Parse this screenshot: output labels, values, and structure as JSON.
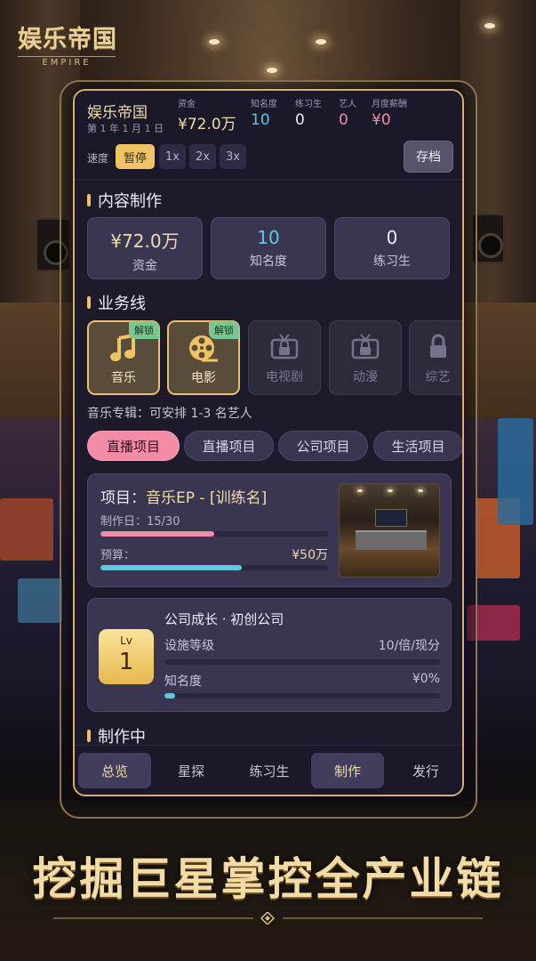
{
  "logo": {
    "title": "娱乐帝国",
    "subtitle": "EMPIRE"
  },
  "header": {
    "game_title": "娱乐帝国",
    "date": "第 1 年 1 月 1 日",
    "stats": [
      {
        "label": "资金",
        "value": "¥72.0万",
        "color": "#f1dca8"
      },
      {
        "label": "知名度",
        "value": "10",
        "color": "#5ec8e0"
      },
      {
        "label": "练习生",
        "value": "0",
        "color": "#ecebf5"
      },
      {
        "label": "艺人",
        "value": "0",
        "color": "#f28ca7"
      },
      {
        "label": "月度薪酬",
        "value": "¥0",
        "color": "#f28ca7"
      }
    ],
    "speed_label": "速度",
    "speed_options": [
      "暂停",
      "1x",
      "2x",
      "3x"
    ],
    "speed_selected": "暂停",
    "save_label": "存档"
  },
  "content_section": {
    "title": "内容制作",
    "cards": [
      {
        "value": "¥72.0万",
        "label": "资金",
        "color": "#f1dca8"
      },
      {
        "value": "10",
        "label": "知名度",
        "color": "#5ec8e0"
      },
      {
        "value": "0",
        "label": "练习生",
        "color": "#ecebf5"
      }
    ]
  },
  "business_section": {
    "title": "业务线",
    "items": [
      {
        "name": "音乐",
        "icon": "music-note-icon",
        "unlocked": true,
        "tag": "解锁"
      },
      {
        "name": "电影",
        "icon": "film-reel-icon",
        "unlocked": true,
        "tag": "解锁"
      },
      {
        "name": "电视剧",
        "icon": "lock-tv-icon",
        "unlocked": false
      },
      {
        "name": "动漫",
        "icon": "lock-tv-icon",
        "unlocked": false
      },
      {
        "name": "综艺",
        "icon": "lock-icon",
        "unlocked": false
      }
    ],
    "note": "音乐专辑：可安排 1-3 名艺人"
  },
  "project_tabs": [
    "直播项目",
    "直播项目",
    "公司项目",
    "生活项目"
  ],
  "project_tab_active": 0,
  "project": {
    "prefix": "项目：",
    "name": "音乐EP - [训练名]",
    "day_text": "制作日：15/30",
    "day_progress": 0.5,
    "budget_label": "预算：",
    "budget_value": "¥50万",
    "budget_progress": 0.62,
    "accent_pink": "#f28ca7",
    "accent_cyan": "#5ec8e0"
  },
  "growth": {
    "level_label": "Lv",
    "level": "1",
    "title": "公司成长 · 初创公司",
    "rows": [
      {
        "label": "设施等级",
        "value": "10/倍/现分",
        "progress": 0.0
      },
      {
        "label": "知名度",
        "value": "¥0%",
        "progress": 0.04
      }
    ]
  },
  "in_production": {
    "title": "制作中"
  },
  "nav": {
    "items": [
      "总览",
      "星探",
      "练习生",
      "制作",
      "发行"
    ],
    "active": [
      0,
      3
    ]
  },
  "slogan": "挖掘巨星掌控全产业链"
}
